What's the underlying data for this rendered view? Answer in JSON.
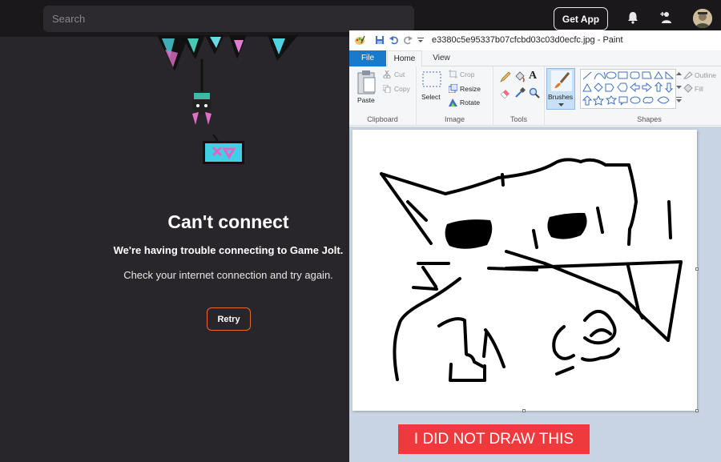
{
  "gamejolt": {
    "search": {
      "placeholder": "Search"
    },
    "get_app_label": "Get App",
    "error": {
      "title": "Can't connect",
      "subtitle": "We're having trouble connecting to Game Jolt.",
      "hint": "Check your internet connection and try again.",
      "retry_label": "Retry"
    },
    "icons": [
      "bell-icon",
      "friends-icon",
      "user-avatar"
    ],
    "accent_color": "#e6692b"
  },
  "paint": {
    "window_title": "e3380c5e95337b07cfcbd03c03d0ecfc.jpg - Paint",
    "tabs": {
      "file": "File",
      "home": "Home",
      "view": "View"
    },
    "clipboard": {
      "paste": "Paste",
      "cut": "Cut",
      "copy": "Copy",
      "group": "Clipboard"
    },
    "image": {
      "select": "Select",
      "crop": "Crop",
      "resize": "Resize",
      "rotate": "Rotate",
      "group": "Image"
    },
    "tools": {
      "group": "Tools"
    },
    "brushes": {
      "label": "Brushes"
    },
    "shapes": {
      "outline": "Outline",
      "fill": "Fill",
      "group": "Shapes"
    },
    "file_tab_color": "#1979ca"
  },
  "caption": {
    "text": "I DID NOT DRAW THIS",
    "color": "#ee3a3d"
  }
}
